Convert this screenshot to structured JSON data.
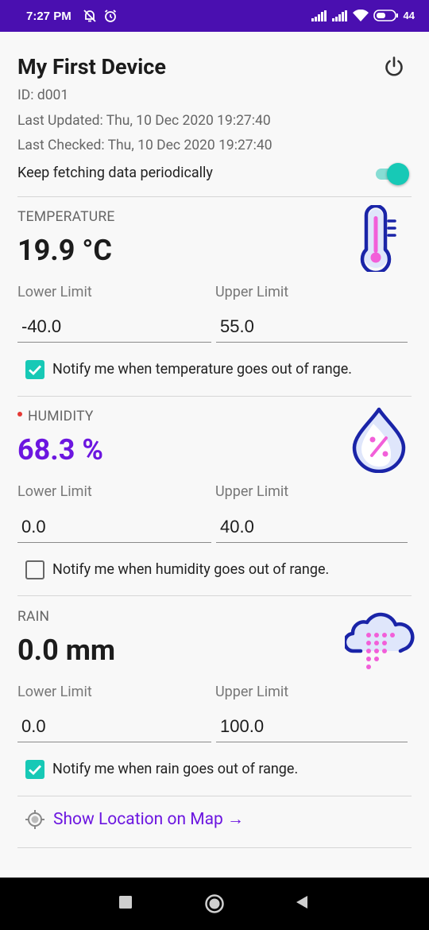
{
  "status_bar": {
    "time": "7:27 PM",
    "battery": "44"
  },
  "device": {
    "title": "My First Device",
    "id": "ID: d001",
    "last_updated": "Last Updated: Thu, 10 Dec 2020 19:27:40",
    "last_checked": "Last Checked: Thu, 10 Dec 2020 19:27:40",
    "keep_fetching_label": "Keep fetching data periodically",
    "keep_fetching_on": true
  },
  "sections": {
    "temperature": {
      "label": "TEMPERATURE",
      "value": "19.9 °C",
      "lower_label": "Lower Limit",
      "upper_label": "Upper Limit",
      "lower_value": "-40.0",
      "upper_value": "55.0",
      "notify_label": "Notify me when temperature goes out of range.",
      "notify_checked": true,
      "icon": "thermometer-icon"
    },
    "humidity": {
      "label": "HUMIDITY",
      "value": "68.3 %",
      "lower_label": "Lower Limit",
      "upper_label": "Upper Limit",
      "lower_value": "0.0",
      "upper_value": "40.0",
      "notify_label": "Notify me when humidity goes out of range.",
      "notify_checked": false,
      "icon": "humidity-drop-icon"
    },
    "rain": {
      "label": "RAIN",
      "value": "0.0 mm",
      "lower_label": "Lower Limit",
      "upper_label": "Upper Limit",
      "lower_value": "0.0",
      "upper_value": "100.0",
      "notify_label": "Notify me when rain goes out of range.",
      "notify_checked": true,
      "icon": "rain-cloud-icon"
    }
  },
  "map_link": {
    "label": "Show Location on Map →",
    "icon": "location-target-icon"
  },
  "colors": {
    "status_bar": "#4a0fb0",
    "accent_teal": "#17c9b6",
    "alert_purple": "#6c16e0",
    "icon_navy": "#1a24a8",
    "icon_pink": "#f25fd9"
  }
}
